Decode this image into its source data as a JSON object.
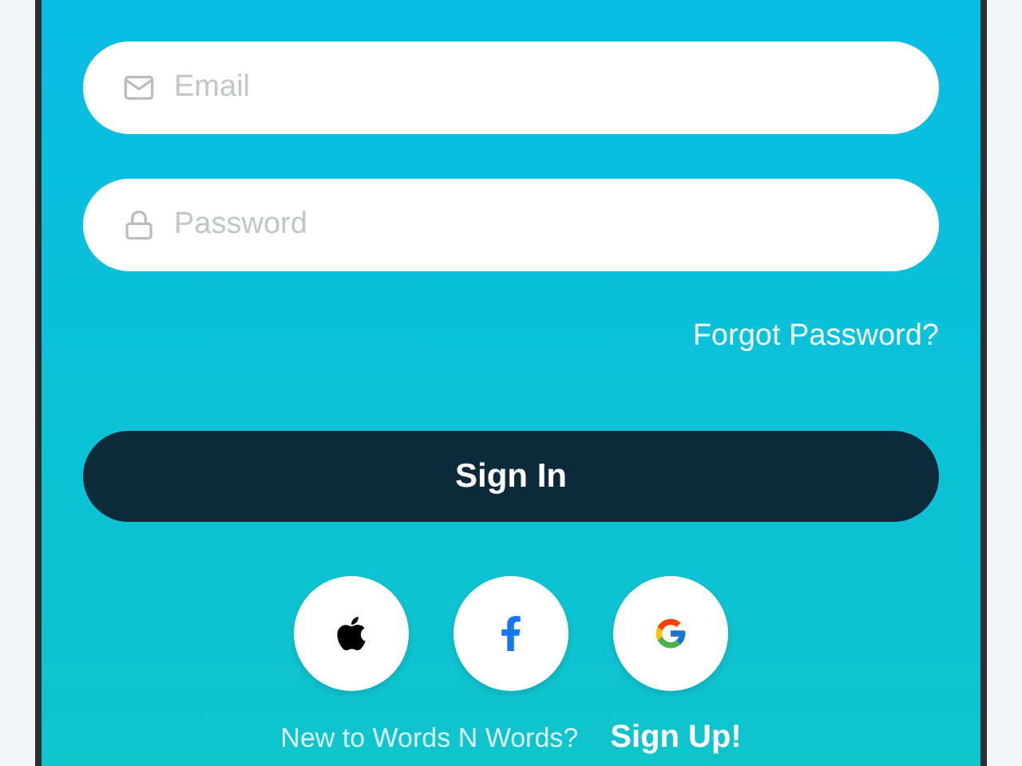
{
  "fields": [
    {
      "kind": "email",
      "placeholder": "Email"
    },
    {
      "kind": "password",
      "placeholder": "Password"
    }
  ],
  "forgot_link": "Forgot Password?",
  "sign_in_button": "Sign In",
  "social_buttons": [
    {
      "kind": "apple"
    },
    {
      "kind": "facebook"
    },
    {
      "kind": "google"
    }
  ],
  "footer": {
    "prompt": "New to Words N Words?",
    "link": "Sign Up!"
  }
}
